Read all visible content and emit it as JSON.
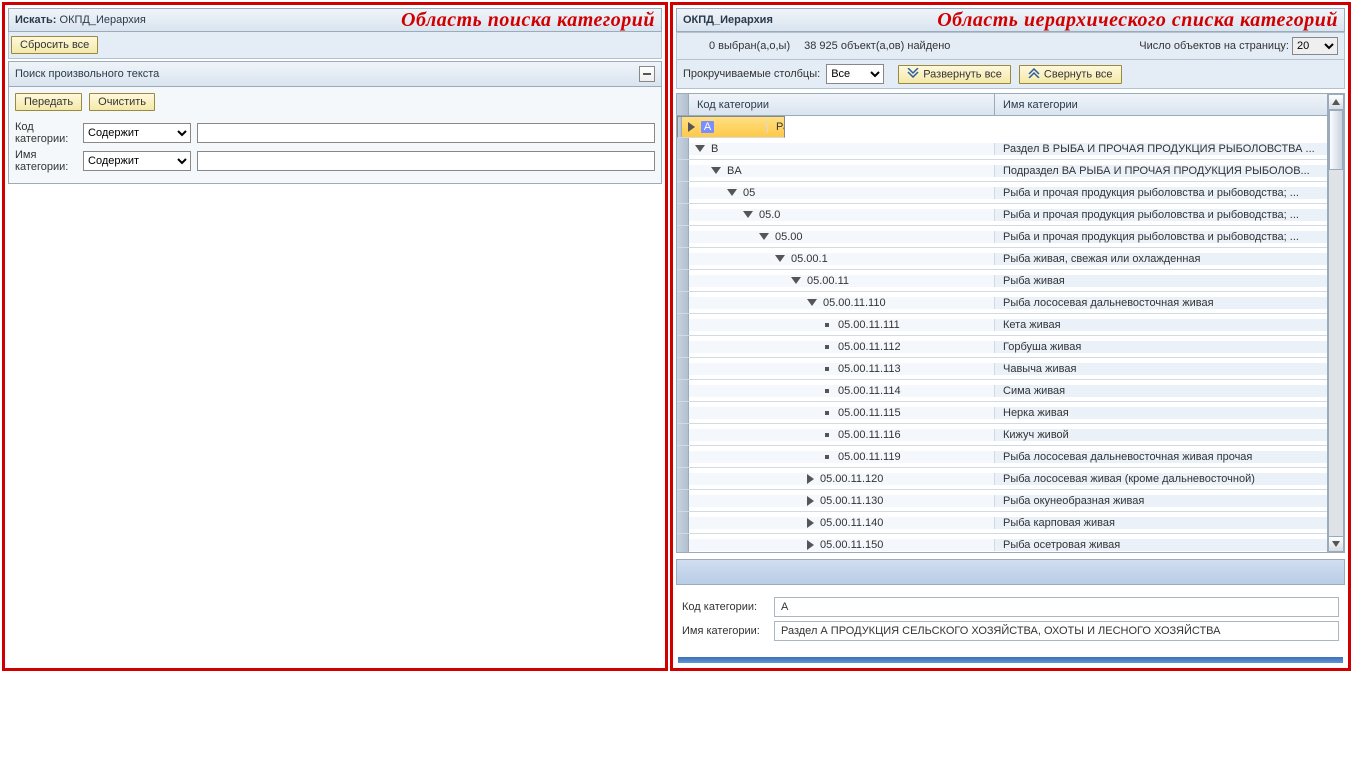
{
  "left": {
    "search_label": "Искать:",
    "hierarchy_name": "ОКПД_Иерархия",
    "caption": "Область поиска категорий",
    "reset_all": "Сбросить все",
    "freetext_title": "Поиск произвольного текста",
    "submit": "Передать",
    "clear": "Очистить",
    "code_label": "Код категории:",
    "name_label": "Имя категории:",
    "op_code": "Содержит",
    "op_name": "Содержит"
  },
  "right": {
    "hierarchy_name": "ОКПД_Иерархия",
    "caption": "Область иерархического списка категорий",
    "selected_text": "0 выбран(а,о,ы)",
    "found_text": "38 925 объект(а,ов) найдено",
    "per_page_label": "Число объектов на страницу:",
    "per_page_value": "20",
    "scroll_cols_label": "Прокручиваемые столбцы:",
    "scroll_cols_value": "Все",
    "expand_all": "Развернуть все",
    "collapse_all": "Свернуть все",
    "col_code": "Код категории",
    "col_name": "Имя категории",
    "rows": [
      {
        "indent": 0,
        "icon": "right",
        "code": "A",
        "name": "Раздел А ПРОДУКЦИЯ СЕЛЬСКОГО ХОЗЯЙСТВА, ОХОТ...",
        "sel": true,
        "hl": true
      },
      {
        "indent": 0,
        "icon": "down",
        "code": "B",
        "name": "Раздел В РЫБА И ПРОЧАЯ ПРОДУКЦИЯ РЫБОЛОВСТВА ..."
      },
      {
        "indent": 1,
        "icon": "down",
        "code": "BA",
        "name": "Подраздел ВА РЫБА И ПРОЧАЯ ПРОДУКЦИЯ РЫБОЛОВ..."
      },
      {
        "indent": 2,
        "icon": "down",
        "code": "05",
        "name": "Рыба и прочая продукция рыболовства и рыбоводства; ..."
      },
      {
        "indent": 3,
        "icon": "down",
        "code": "05.0",
        "name": "Рыба и прочая продукция рыболовства и рыбоводства; ..."
      },
      {
        "indent": 4,
        "icon": "down",
        "code": "05.00",
        "name": "Рыба и прочая продукция рыболовства и рыбоводства; ..."
      },
      {
        "indent": 5,
        "icon": "down",
        "code": "05.00.1",
        "name": "Рыба живая, свежая или охлажденная"
      },
      {
        "indent": 6,
        "icon": "down",
        "code": "05.00.11",
        "name": "Рыба живая"
      },
      {
        "indent": 7,
        "icon": "down",
        "code": "05.00.11.110",
        "name": "Рыба лососевая дальневосточная живая"
      },
      {
        "indent": 8,
        "icon": "dot",
        "code": "05.00.11.111",
        "name": "Кета живая"
      },
      {
        "indent": 8,
        "icon": "dot",
        "code": "05.00.11.112",
        "name": "Горбуша живая"
      },
      {
        "indent": 8,
        "icon": "dot",
        "code": "05.00.11.113",
        "name": "Чавыча живая"
      },
      {
        "indent": 8,
        "icon": "dot",
        "code": "05.00.11.114",
        "name": "Сима живая"
      },
      {
        "indent": 8,
        "icon": "dot",
        "code": "05.00.11.115",
        "name": "Нерка живая"
      },
      {
        "indent": 8,
        "icon": "dot",
        "code": "05.00.11.116",
        "name": "Кижуч живой"
      },
      {
        "indent": 8,
        "icon": "dot",
        "code": "05.00.11.119",
        "name": "Рыба лососевая дальневосточная живая прочая"
      },
      {
        "indent": 7,
        "icon": "right",
        "code": "05.00.11.120",
        "name": "Рыба лососевая живая (кроме дальневосточной)"
      },
      {
        "indent": 7,
        "icon": "right",
        "code": "05.00.11.130",
        "name": "Рыба окунеобразная живая"
      },
      {
        "indent": 7,
        "icon": "right",
        "code": "05.00.11.140",
        "name": "Рыба карповая живая"
      },
      {
        "indent": 7,
        "icon": "right",
        "code": "05.00.11.150",
        "name": "Рыба осетровая живая"
      }
    ],
    "detail": {
      "code_label": "Код категории:",
      "name_label": "Имя категории:",
      "code_value": "A",
      "name_value": "Раздел А ПРОДУКЦИЯ СЕЛЬСКОГО ХОЗЯЙСТВА, ОХОТЫ И ЛЕСНОГО ХОЗЯЙСТВА"
    }
  }
}
